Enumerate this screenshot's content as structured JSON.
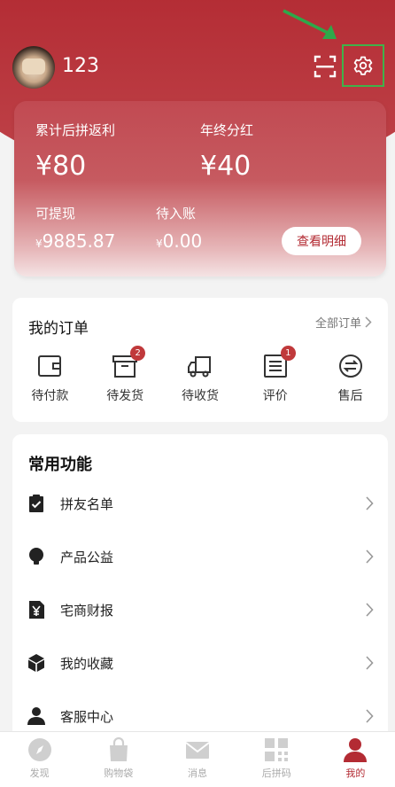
{
  "user": {
    "name": "123"
  },
  "earnings": {
    "cumulative_label": "累计后拼返利",
    "cumulative_value": "¥80",
    "yearend_label": "年终分红",
    "yearend_value": "¥40",
    "withdrawable_label": "可提现",
    "withdrawable_currency": "¥",
    "withdrawable_value": "9885.87",
    "pending_label": "待入账",
    "pending_currency": "¥",
    "pending_value": "0.00",
    "detail_button": "查看明细"
  },
  "orders": {
    "title": "我的订单",
    "all_link": "全部订单",
    "items": [
      {
        "label": "待付款",
        "icon": "wallet-icon",
        "badge": ""
      },
      {
        "label": "待发货",
        "icon": "box-icon",
        "badge": "2"
      },
      {
        "label": "待收货",
        "icon": "truck-icon",
        "badge": ""
      },
      {
        "label": "评价",
        "icon": "review-icon",
        "badge": "1"
      },
      {
        "label": "售后",
        "icon": "exchange-icon",
        "badge": ""
      }
    ]
  },
  "functions": {
    "title": "常用功能",
    "items": [
      {
        "label": "拼友名单",
        "icon": "clipboard-check-icon"
      },
      {
        "label": "产品公益",
        "icon": "lightbulb-icon"
      },
      {
        "label": "宅商财报",
        "icon": "yen-document-icon"
      },
      {
        "label": "我的收藏",
        "icon": "cube-icon"
      },
      {
        "label": "客服中心",
        "icon": "person-icon"
      }
    ]
  },
  "tabbar": {
    "tabs": [
      {
        "label": "发现",
        "icon": "compass-icon",
        "active": false
      },
      {
        "label": "购物袋",
        "icon": "bag-icon",
        "active": false
      },
      {
        "label": "消息",
        "icon": "envelope-icon",
        "active": false
      },
      {
        "label": "后拼码",
        "icon": "qr-code-icon",
        "active": false
      },
      {
        "label": "我的",
        "icon": "profile-icon",
        "active": true
      }
    ]
  },
  "colors": {
    "brand": "#b32b33",
    "highlight_box": "#3fb24a",
    "annotation_arrow": "#2ea84a"
  }
}
